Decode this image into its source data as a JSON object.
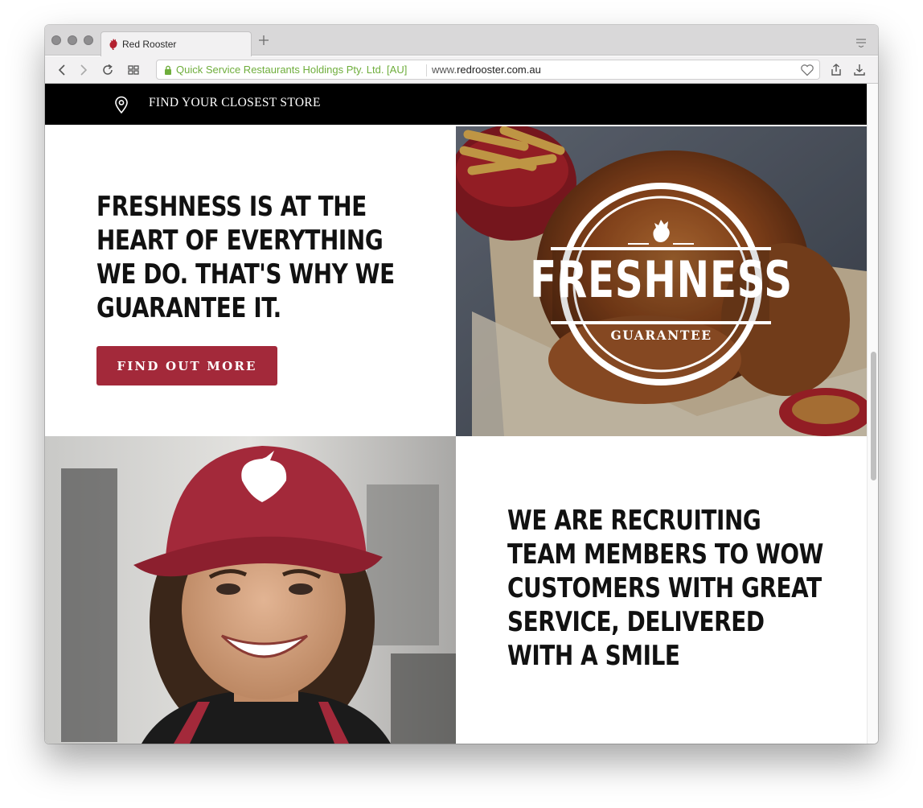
{
  "browser": {
    "tab_title": "Red Rooster",
    "certificate": "Quick Service Restaurants Holdings Pty. Ltd. [AU]",
    "url_prefix": "www.",
    "url_host": "redrooster.com.au"
  },
  "store_bar": {
    "label": "FIND YOUR CLOSEST STORE"
  },
  "freshness_block": {
    "title": "FRESHNESS IS AT THE HEART OF EVERYTHING WE DO. THAT'S WHY WE GUARANTEE IT.",
    "button_label": "FIND OUT MORE",
    "badge_main": "FRESHNESS",
    "badge_sub": "GUARANTEE"
  },
  "recruit_block": {
    "title": "WE ARE RECRUITING TEAM MEMBERS TO WOW CUSTOMERS WITH GREAT SERVICE, DELIVERED WITH A SMILE"
  },
  "colors": {
    "brand_red": "#a3293a",
    "store_bar_bg": "#000000",
    "certificate_green": "#6fae3c"
  }
}
